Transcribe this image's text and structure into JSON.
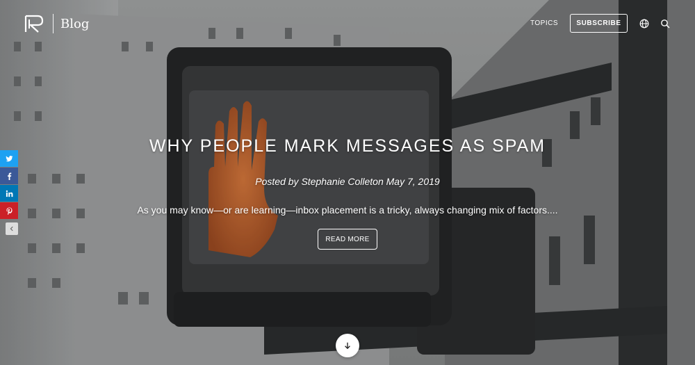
{
  "header": {
    "blog_label": "Blog",
    "nav": {
      "topics_label": "TOPICS",
      "subscribe_label": "SUBSCRIBE"
    },
    "icons": [
      "logo-icon",
      "globe-icon",
      "search-icon"
    ]
  },
  "share": {
    "items": [
      {
        "name": "twitter",
        "color": "#1da1f2"
      },
      {
        "name": "facebook",
        "color": "#3b5998"
      },
      {
        "name": "linkedin",
        "color": "#0077b5"
      },
      {
        "name": "pinterest",
        "color": "#cb2027"
      }
    ],
    "collapse_icon": "chevron-left-icon"
  },
  "article": {
    "title": "WHY PEOPLE MARK MESSAGES AS SPAM",
    "byline": "Posted by Stephanie Colleton May 7, 2019",
    "excerpt": "As you may know—or are learning—inbox placement is a tricky, always changing mix of factors....",
    "read_more_label": "READ MORE"
  },
  "scroll_down_icon": "arrow-down-icon"
}
